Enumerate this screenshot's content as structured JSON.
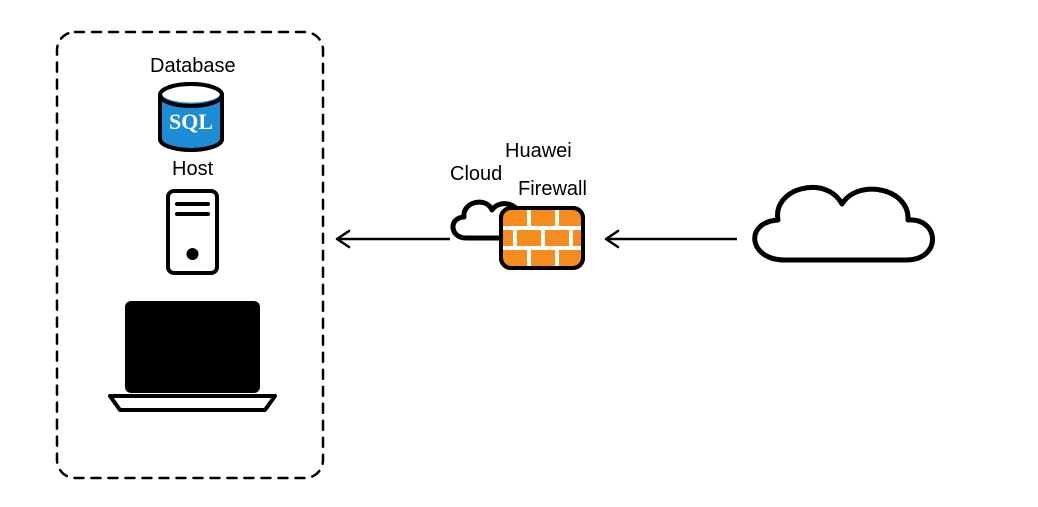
{
  "labels": {
    "database": "Database",
    "sql": "SQL",
    "host": "Host",
    "huawei": "Huawei",
    "cloud": "Cloud",
    "firewall": "Firewall"
  },
  "colors": {
    "db_fill": "#1c8cd6",
    "firewall_fill": "#f58c1f",
    "stroke": "#000000",
    "sql_text": "#ffffff"
  }
}
